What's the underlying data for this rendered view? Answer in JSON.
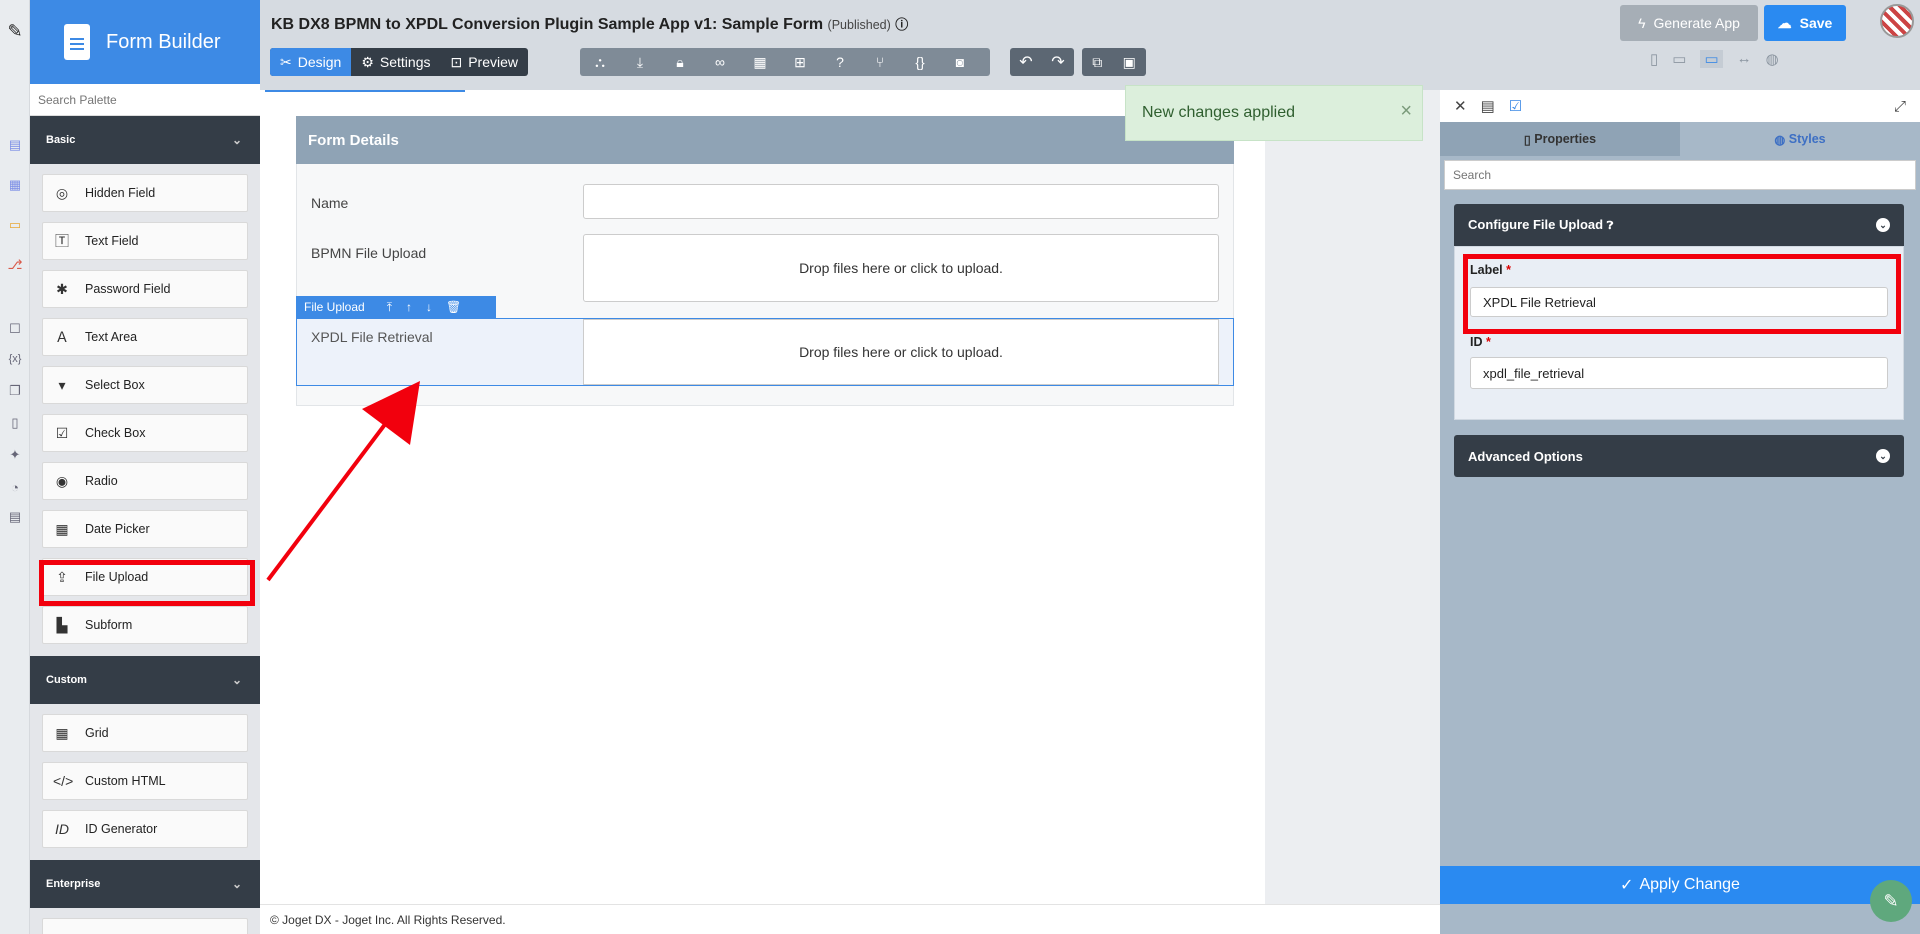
{
  "palette": {
    "brand_title": "Form Builder",
    "search_placeholder": "Search Palette",
    "categories": {
      "basic": "Basic",
      "custom": "Custom",
      "enterprise": "Enterprise"
    },
    "basic_items": [
      "Hidden Field",
      "Text Field",
      "Password Field",
      "Text Area",
      "Select Box",
      "Check Box",
      "Radio",
      "Date Picker",
      "File Upload",
      "Subform"
    ],
    "custom_items": [
      "Grid",
      "Custom HTML",
      "ID Generator"
    ]
  },
  "header": {
    "app_title": "KB DX8 BPMN to XPDL Conversion Plugin Sample App v1: Sample Form",
    "published": "(Published)",
    "tabs": [
      "Design",
      "Settings",
      "Preview"
    ],
    "generate_app": "Generate App",
    "save": "Save"
  },
  "toast": {
    "message": "New changes applied"
  },
  "form": {
    "section_title": "Form Details",
    "fields": [
      {
        "label": "Name"
      },
      {
        "label": "BPMN File Upload",
        "dropzone": "Drop files here or click to upload."
      },
      {
        "label": "XPDL File Retrieval",
        "dropzone": "Drop files here or click to upload."
      }
    ],
    "selected_toolbar_label": "File Upload"
  },
  "properties": {
    "tabs": [
      "Properties",
      "Styles"
    ],
    "search_placeholder": "Search",
    "section_configure": "Configure File Upload",
    "label_field": {
      "label": "Label",
      "value": "XPDL File Retrieval"
    },
    "id_field": {
      "label": "ID",
      "value": "xpdl_file_retrieval"
    },
    "section_advanced": "Advanced Options",
    "apply": "Apply Change"
  },
  "footer": {
    "text": "© Joget DX - Joget Inc. All Rights Reserved."
  },
  "colors": {
    "accent": "#3d8ae5",
    "dark": "#343d47",
    "annotation_red": "#f2000d"
  }
}
